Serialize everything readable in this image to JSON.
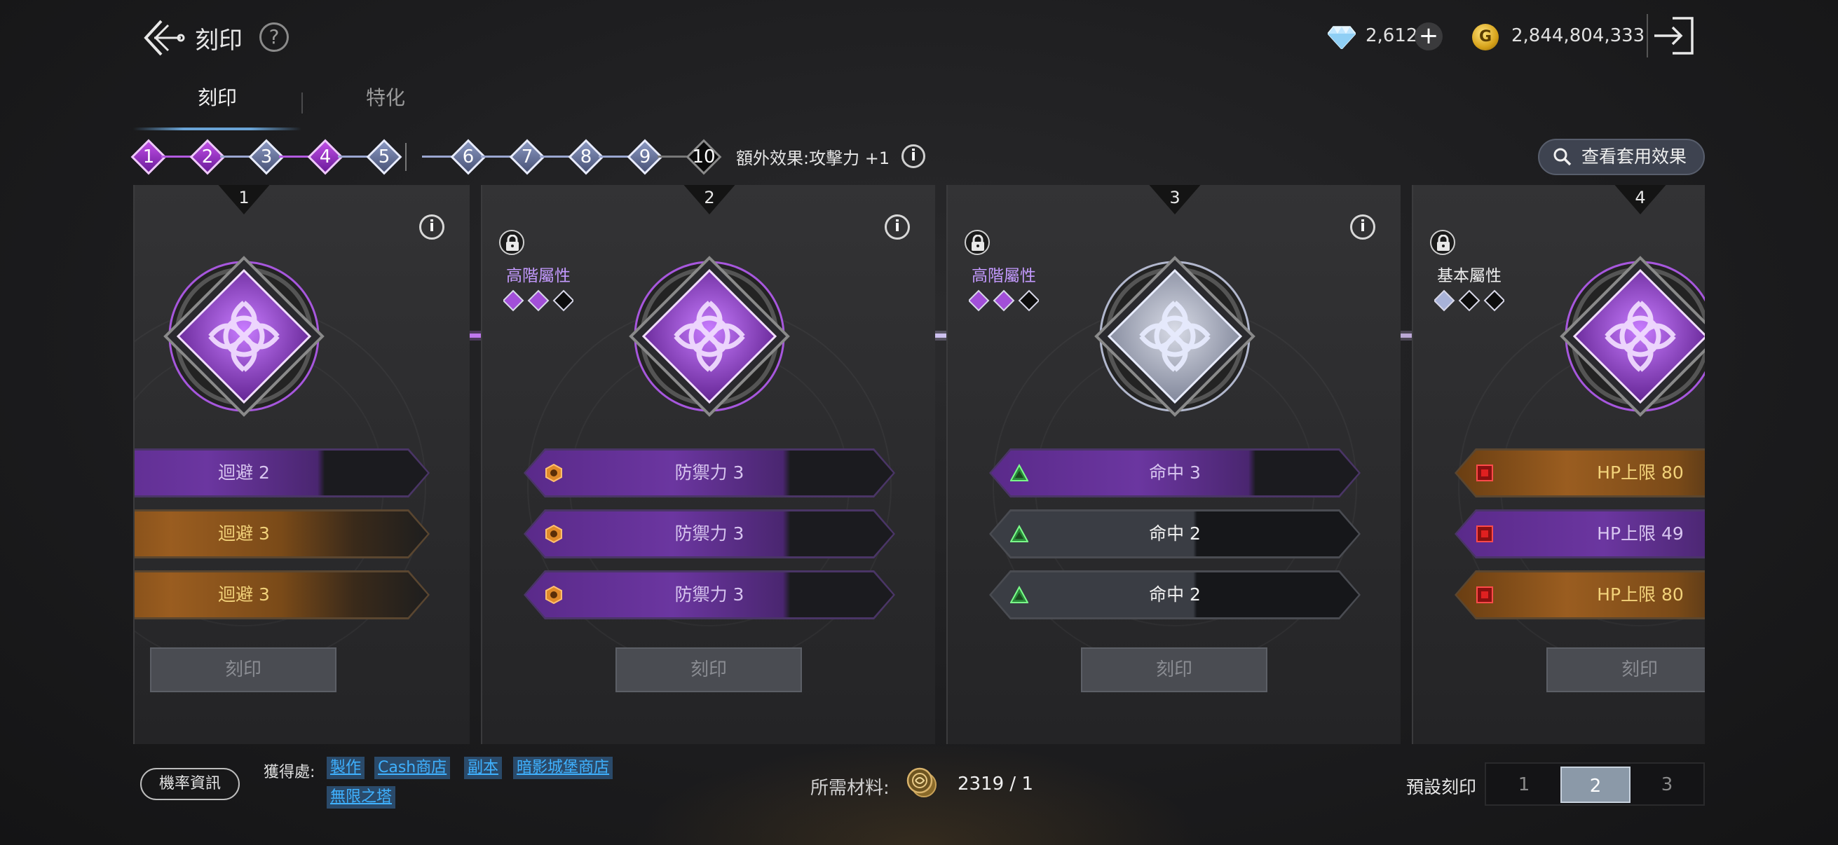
{
  "header": {
    "title": "刻印",
    "help_label": "?",
    "gems": "2,612",
    "gems_add": "+",
    "gold_icon_letter": "G",
    "gold": "2,844,804,333"
  },
  "tabs": [
    {
      "label": "刻印",
      "active": true
    },
    {
      "label": "特化",
      "active": false
    }
  ],
  "levels": [
    {
      "num": "1",
      "tier": "purple"
    },
    {
      "num": "2",
      "tier": "purple"
    },
    {
      "num": "3",
      "tier": "blue"
    },
    {
      "num": "4",
      "tier": "purple"
    },
    {
      "num": "5",
      "tier": "blue"
    },
    {
      "num": "6",
      "tier": "blue"
    },
    {
      "num": "7",
      "tier": "blue"
    },
    {
      "num": "8",
      "tier": "blue"
    },
    {
      "num": "9",
      "tier": "blue"
    },
    {
      "num": "10",
      "tier": "black"
    }
  ],
  "bonus_effect": "額外效果:攻擊力 +1",
  "info_glyph": "i",
  "view_effects_button": "查看套用效果",
  "panels": [
    {
      "num": "1",
      "gem_tier": "purple",
      "locked": false,
      "attr_label": "",
      "rows": [
        {
          "text": "迴避 2",
          "tier": "purple",
          "icon": "none"
        },
        {
          "text": "迴避 3",
          "tier": "orange",
          "icon": "none"
        },
        {
          "text": "迴避 3",
          "tier": "orange",
          "icon": "none"
        }
      ],
      "button": "刻印"
    },
    {
      "num": "2",
      "gem_tier": "purple",
      "locked": true,
      "attr_label": "高階屬性",
      "attr_dots": [
        "purple",
        "purple",
        "black"
      ],
      "rows": [
        {
          "text": "防禦力 3",
          "tier": "purple",
          "icon": "hexagon-orange"
        },
        {
          "text": "防禦力 3",
          "tier": "purple",
          "icon": "hexagon-orange"
        },
        {
          "text": "防禦力 3",
          "tier": "purple",
          "icon": "hexagon-orange"
        }
      ],
      "button": "刻印"
    },
    {
      "num": "3",
      "gem_tier": "silver",
      "locked": true,
      "attr_label": "高階屬性",
      "attr_dots": [
        "purple",
        "purple",
        "black"
      ],
      "rows": [
        {
          "text": "命中 3",
          "tier": "purple",
          "icon": "triangle-green"
        },
        {
          "text": "命中 2",
          "tier": "grey",
          "icon": "triangle-green"
        },
        {
          "text": "命中 2",
          "tier": "grey",
          "icon": "triangle-green"
        }
      ],
      "button": "刻印"
    },
    {
      "num": "4",
      "gem_tier": "purple",
      "locked": true,
      "attr_label": "基本屬性",
      "attr_dots": [
        "blue",
        "black",
        "black"
      ],
      "rows": [
        {
          "text": "HP上限 80",
          "tier": "orange",
          "icon": "square-red"
        },
        {
          "text": "HP上限 49",
          "tier": "purple",
          "icon": "square-red"
        },
        {
          "text": "HP上限 80",
          "tier": "orange",
          "icon": "square-red"
        }
      ],
      "button": "刻印"
    }
  ],
  "bottom": {
    "probability_button": "機率資訊",
    "obtain_label": "獲得處:",
    "sources": [
      "製作",
      "Cash商店",
      "副本",
      "暗影城堡商店",
      "無限之塔"
    ],
    "material_label": "所需材料:",
    "material_value": "2319 / 1",
    "preset_label": "預設刻印",
    "presets": [
      "1",
      "2",
      "3"
    ],
    "preset_selected": "2"
  },
  "colors": {
    "purple": "#8a3fc0",
    "orange": "#b06a1e",
    "silver": "#aeb6cc",
    "link": "#3fb1ff"
  }
}
